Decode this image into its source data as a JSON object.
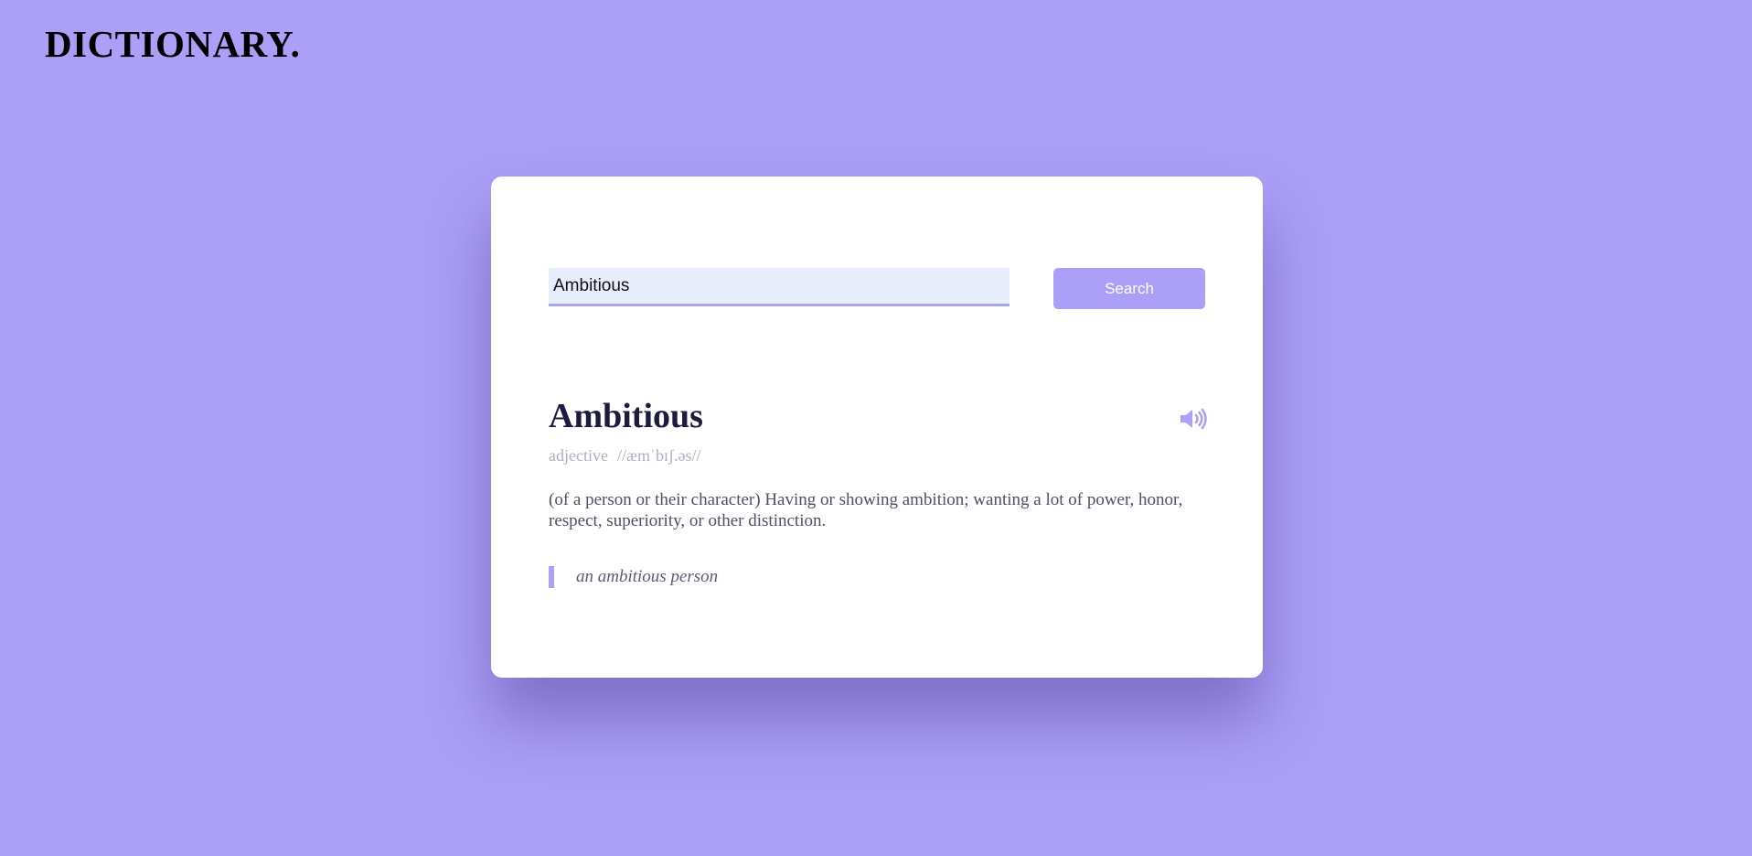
{
  "header": {
    "brand": "DICTIONARY."
  },
  "search": {
    "value": "Ambitious",
    "button_label": "Search"
  },
  "result": {
    "word": "Ambitious",
    "part_of_speech": "adjective",
    "phonetic": "//æmˈbɪʃ.əs//",
    "definition": "(of a person or their character) Having or showing ambition; wanting a lot of power, honor, respect, superiority, or other distinction.",
    "example": "an ambitious person",
    "audio_icon": "speaker-icon"
  },
  "colors": {
    "background": "#ab9ff7",
    "accent": "#ab9ff7",
    "card": "#ffffff",
    "input_background": "#e8edfc",
    "title_text": "#1d1b3f",
    "muted_text": "#b0acc4",
    "body_text": "#4d5068"
  }
}
